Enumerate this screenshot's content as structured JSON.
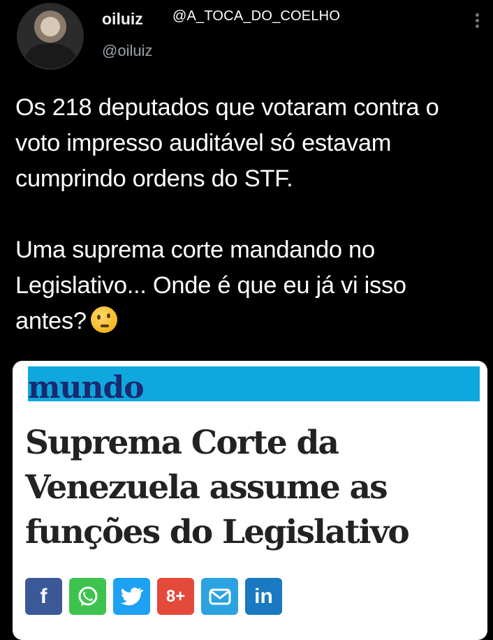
{
  "tweet": {
    "display_name": "oiluiz",
    "handle": "@oiluiz",
    "paragraph_1": "Os 218 deputados que votaram contra o voto impresso auditável só estavam cumprindo ordens do STF.",
    "paragraph_2": "Uma suprema corte mandando no Legislativo... Onde é que eu já vi isso antes?"
  },
  "watermark": "@A_TOCA_DO_COELHO",
  "article_card": {
    "section": "mundo",
    "headline": "Suprema Corte da Venezuela assume as funções do Legislativo",
    "share_buttons": [
      {
        "name": "facebook",
        "glyph": "f",
        "color": "#3b5998"
      },
      {
        "name": "whatsapp",
        "glyph": "",
        "color": "#3fc34f"
      },
      {
        "name": "twitter",
        "glyph": "",
        "color": "#1da1f2"
      },
      {
        "name": "google-plus",
        "glyph": "8+",
        "color": "#e34a3a"
      },
      {
        "name": "email",
        "glyph": "",
        "color": "#2ba3e0"
      },
      {
        "name": "linkedin",
        "glyph": "in",
        "color": "#1a79c0"
      }
    ]
  },
  "icons": {
    "emoji": "thinking-face-icon",
    "more": "more-vertical-icon"
  }
}
